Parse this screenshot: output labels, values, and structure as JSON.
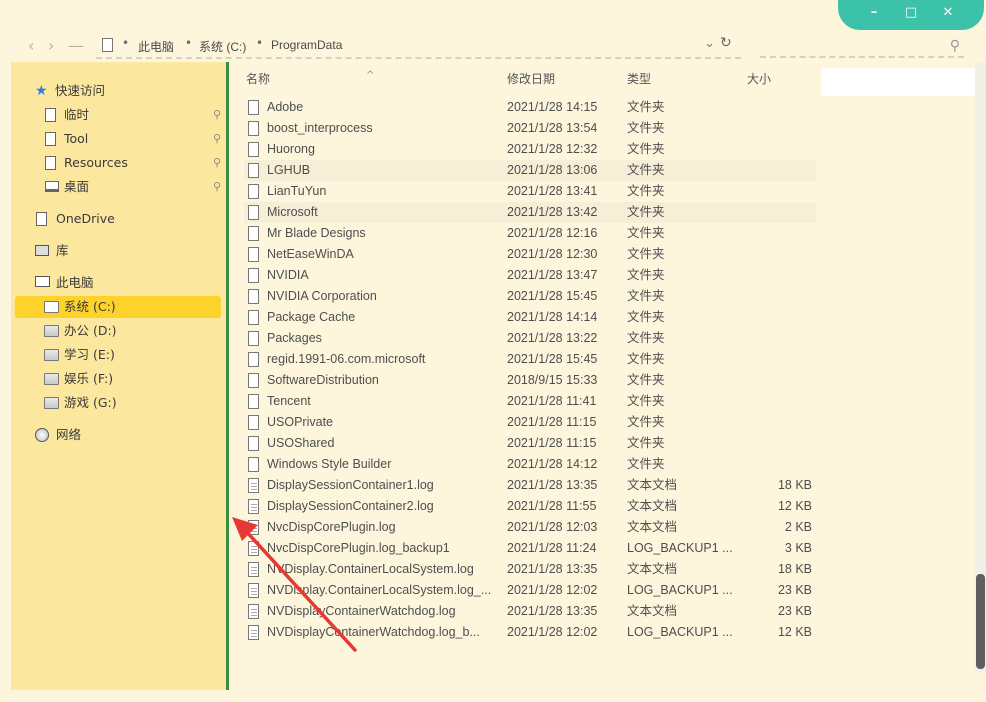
{
  "window_controls": {
    "minimize": "–",
    "maximize": "□",
    "close": "✕"
  },
  "nav": {
    "back": "‹",
    "forward": "›",
    "up": "—"
  },
  "address": {
    "crumbs": [
      "此电脑",
      "系统 (C:)",
      "ProgramData"
    ],
    "dropdown": "⌄",
    "refresh": "↻"
  },
  "search": {
    "icon": "⚲"
  },
  "sidebar": {
    "quick_access": "快速访问",
    "items": [
      {
        "label": "临时",
        "icon": "document-icon",
        "pinned": true
      },
      {
        "label": "Tool",
        "icon": "document-icon",
        "pinned": true
      },
      {
        "label": "Resources",
        "icon": "document-icon",
        "pinned": true
      },
      {
        "label": "桌面",
        "icon": "desktop-icon",
        "pinned": true
      }
    ],
    "onedrive": "OneDrive",
    "library": "库",
    "this_pc": "此电脑",
    "drives": [
      {
        "label": "系统 (C:)",
        "selected": true
      },
      {
        "label": "办公 (D:)",
        "selected": false
      },
      {
        "label": "学习 (E:)",
        "selected": false
      },
      {
        "label": "娱乐 (F:)",
        "selected": false
      },
      {
        "label": "游戏 (G:)",
        "selected": false
      }
    ],
    "network": "网络",
    "pin_glyph": "📌"
  },
  "columns": {
    "name": "名称",
    "date": "修改日期",
    "type": "类型",
    "size": "大小",
    "sort_indicator": "^"
  },
  "files": [
    {
      "name": "Adobe",
      "date": "2021/1/28 14:15",
      "type": "文件夹",
      "size": "",
      "kind": "folder"
    },
    {
      "name": "boost_interprocess",
      "date": "2021/1/28 13:54",
      "type": "文件夹",
      "size": "",
      "kind": "folder"
    },
    {
      "name": "Huorong",
      "date": "2021/1/28 12:32",
      "type": "文件夹",
      "size": "",
      "kind": "folder"
    },
    {
      "name": "LGHUB",
      "date": "2021/1/28 13:06",
      "type": "文件夹",
      "size": "",
      "kind": "folder",
      "highlight": true
    },
    {
      "name": "LianTuYun",
      "date": "2021/1/28 13:41",
      "type": "文件夹",
      "size": "",
      "kind": "folder"
    },
    {
      "name": "Microsoft",
      "date": "2021/1/28 13:42",
      "type": "文件夹",
      "size": "",
      "kind": "folder",
      "highlight": true
    },
    {
      "name": "Mr Blade Designs",
      "date": "2021/1/28 12:16",
      "type": "文件夹",
      "size": "",
      "kind": "folder"
    },
    {
      "name": "NetEaseWinDA",
      "date": "2021/1/28 12:30",
      "type": "文件夹",
      "size": "",
      "kind": "folder"
    },
    {
      "name": "NVIDIA",
      "date": "2021/1/28 13:47",
      "type": "文件夹",
      "size": "",
      "kind": "folder"
    },
    {
      "name": "NVIDIA Corporation",
      "date": "2021/1/28 15:45",
      "type": "文件夹",
      "size": "",
      "kind": "folder"
    },
    {
      "name": "Package Cache",
      "date": "2021/1/28 14:14",
      "type": "文件夹",
      "size": "",
      "kind": "folder"
    },
    {
      "name": "Packages",
      "date": "2021/1/28 13:22",
      "type": "文件夹",
      "size": "",
      "kind": "folder"
    },
    {
      "name": "regid.1991-06.com.microsoft",
      "date": "2021/1/28 15:45",
      "type": "文件夹",
      "size": "",
      "kind": "folder"
    },
    {
      "name": "SoftwareDistribution",
      "date": "2018/9/15 15:33",
      "type": "文件夹",
      "size": "",
      "kind": "folder"
    },
    {
      "name": "Tencent",
      "date": "2021/1/28 11:41",
      "type": "文件夹",
      "size": "",
      "kind": "folder"
    },
    {
      "name": "USOPrivate",
      "date": "2021/1/28 11:15",
      "type": "文件夹",
      "size": "",
      "kind": "folder"
    },
    {
      "name": "USOShared",
      "date": "2021/1/28 11:15",
      "type": "文件夹",
      "size": "",
      "kind": "folder"
    },
    {
      "name": "Windows Style Builder",
      "date": "2021/1/28 14:12",
      "type": "文件夹",
      "size": "",
      "kind": "folder"
    },
    {
      "name": "DisplaySessionContainer1.log",
      "date": "2021/1/28 13:35",
      "type": "文本文档",
      "size": "18 KB",
      "kind": "file"
    },
    {
      "name": "DisplaySessionContainer2.log",
      "date": "2021/1/28 11:55",
      "type": "文本文档",
      "size": "12 KB",
      "kind": "file"
    },
    {
      "name": "NvcDispCorePlugin.log",
      "date": "2021/1/28 12:03",
      "type": "文本文档",
      "size": "2 KB",
      "kind": "file"
    },
    {
      "name": "NvcDispCorePlugin.log_backup1",
      "date": "2021/1/28 11:24",
      "type": "LOG_BACKUP1 ...",
      "size": "3 KB",
      "kind": "file"
    },
    {
      "name": "NVDisplay.ContainerLocalSystem.log",
      "date": "2021/1/28 13:35",
      "type": "文本文档",
      "size": "18 KB",
      "kind": "file"
    },
    {
      "name": "NVDisplay.ContainerLocalSystem.log_...",
      "date": "2021/1/28 12:02",
      "type": "LOG_BACKUP1 ...",
      "size": "23 KB",
      "kind": "file"
    },
    {
      "name": "NVDisplayContainerWatchdog.log",
      "date": "2021/1/28 13:35",
      "type": "文本文档",
      "size": "23 KB",
      "kind": "file"
    },
    {
      "name": "NVDisplayContainerWatchdog.log_b...",
      "date": "2021/1/28 12:02",
      "type": "LOG_BACKUP1 ...",
      "size": "12 KB",
      "kind": "file"
    }
  ],
  "colors": {
    "sidebar_bg": "#fbe79e",
    "selected": "#fcd22b",
    "accent_green": "#3e8e41",
    "window_controls": "#3cc2a8",
    "annotation_arrow": "#e53935"
  }
}
